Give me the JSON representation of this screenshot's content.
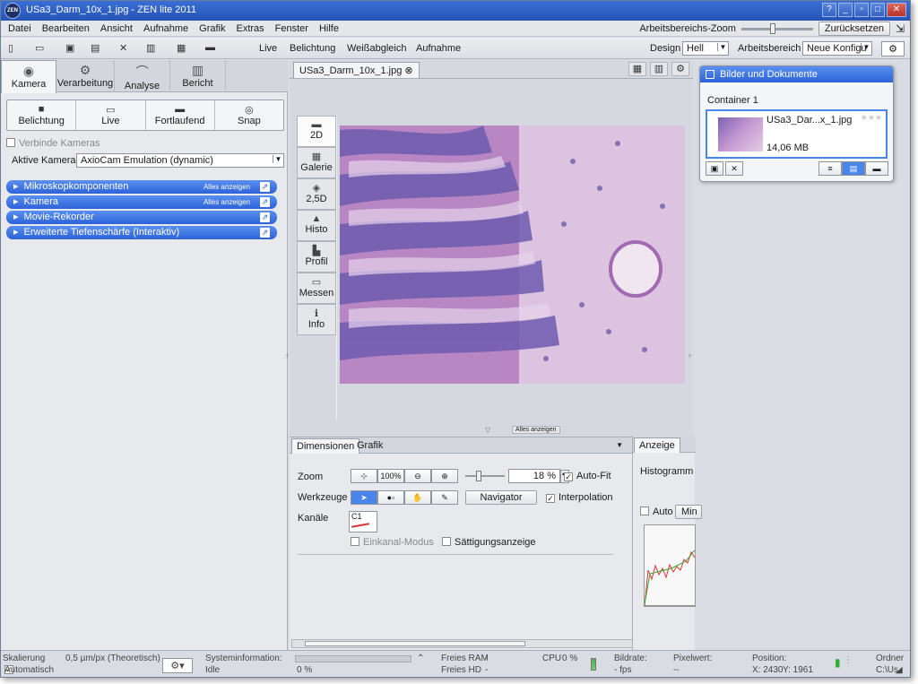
{
  "window": {
    "title": "USa3_Darm_10x_1.jpg - ZEN lite 2011",
    "logo": "ZEN",
    "controls": [
      "?",
      "_",
      "▫",
      "□",
      "✕"
    ]
  },
  "menubar": {
    "items": [
      "Datei",
      "Bearbeiten",
      "Ansicht",
      "Aufnahme",
      "Grafik",
      "Extras",
      "Fenster",
      "Hilfe"
    ],
    "zoom_label": "Arbeitsbereichs-Zoom",
    "reset": "Zurücksetzen"
  },
  "toolbar": {
    "live": "Live",
    "belichtung": "Belichtung",
    "weissabgleich": "Weißabgleich",
    "aufnahme": "Aufnahme",
    "design_label": "Design",
    "design_value": "Hell",
    "workspace_label": "Arbeitsbereich",
    "workspace_value": "Neue Konfigu"
  },
  "left": {
    "tabs": [
      "Kamera",
      "Verarbeitung",
      "Analyse",
      "Bericht"
    ],
    "acq": [
      "Belichtung",
      "Live",
      "Fortlaufend",
      "Snap"
    ],
    "verbinde": "Verbinde Kameras",
    "camera_label": "Aktive Kamera",
    "camera_value": "AxioCam Emulation (dynamic)",
    "panels": [
      {
        "label": "Mikroskopkomponenten",
        "show_all": "Alles anzeigen"
      },
      {
        "label": "Kamera",
        "show_all": "Alles anzeigen"
      },
      {
        "label": "Movie-Rekorder",
        "show_all": ""
      },
      {
        "label": "Erweiterte Tiefenschärfe (Interaktiv)",
        "show_all": ""
      }
    ]
  },
  "center": {
    "doc_tab": "USa3_Darm_10x_1.jpg",
    "view_tabs": [
      "2D",
      "Galerie",
      "2,5D",
      "Histo",
      "Profil",
      "Messen",
      "Info"
    ],
    "show_all": "Alles anzeigen"
  },
  "bottom": {
    "tabs": [
      "Dimensionen",
      "Grafik"
    ],
    "zoom_label": "Zoom",
    "zoom_100": "100%",
    "zoom_value": "18 %",
    "autofit": "Auto-Fit",
    "tools_label": "Werkzeuge",
    "navigator": "Navigator",
    "interpolation": "Interpolation",
    "channels_label": "Kanäle",
    "channel": "C1",
    "einkanal": "Einkanal-Modus",
    "saettigung": "Sättigungsanzeige"
  },
  "right": {
    "tab": "Anzeige",
    "histogram": "Histogramm",
    "auto": "Auto",
    "min": "Min"
  },
  "docs": {
    "title": "Bilder und Dokumente",
    "container": "Container 1",
    "file": "USa3_Dar...x_1.jpg",
    "size": "14,06 MB"
  },
  "status": {
    "skalierung": "Skalierung",
    "skalierung_val": "0,5 µm/px (Theoretisch)",
    "automatisch": "Automatisch",
    "sysinfo": "Systeminformation:",
    "idle": "Idle",
    "progress": "0 %",
    "progress_fraction": 0,
    "ram": "Freies RAM",
    "ram_val": "-",
    "hd": "Freies HD",
    "hd_val": "-",
    "cpu": "CPU",
    "cpu_val": "0 %",
    "bitrate": "Bildrate:",
    "bitrate_val": "- fps",
    "pixel": "Pixelwert:",
    "pixel_val": "--",
    "position": "Position:",
    "x": "X: 2430",
    "y": "Y: 1961",
    "ordner": "Ordner",
    "ordner_val": "C:\\Us"
  }
}
